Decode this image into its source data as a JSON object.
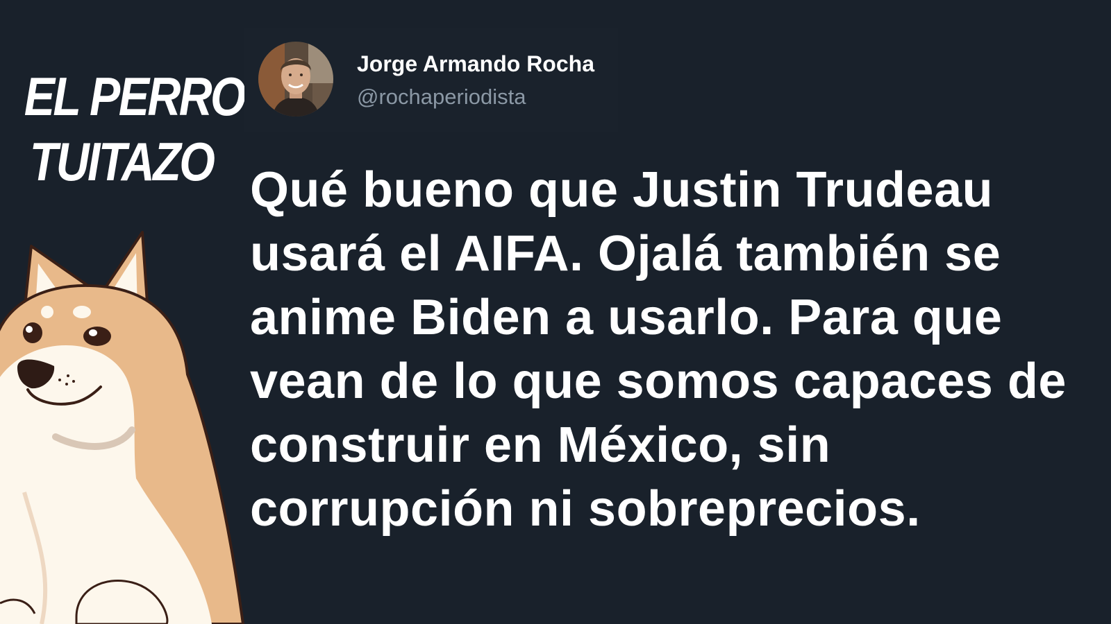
{
  "brand": {
    "line1": "EL PERRO",
    "line2": "TUITAZO"
  },
  "mascot": {
    "icon": "shiba-inu-dog-icon"
  },
  "tweet": {
    "author_name": "Jorge Armando Rocha",
    "author_handle": "@rochaperiodista",
    "avatar_icon": "profile-photo-icon",
    "text": "Qué bueno que Justin Trudeau usará el AIFA. Ojalá también se anime Biden a usarlo. Para que vean de lo que somos capaces de construir en México, sin corrupción ni sobreprecios."
  },
  "colors": {
    "background": "#19212b",
    "text": "#ffffff",
    "handle": "#8b98a5",
    "dog_fur": "#e8b98a",
    "dog_cream": "#fdf7ec"
  }
}
